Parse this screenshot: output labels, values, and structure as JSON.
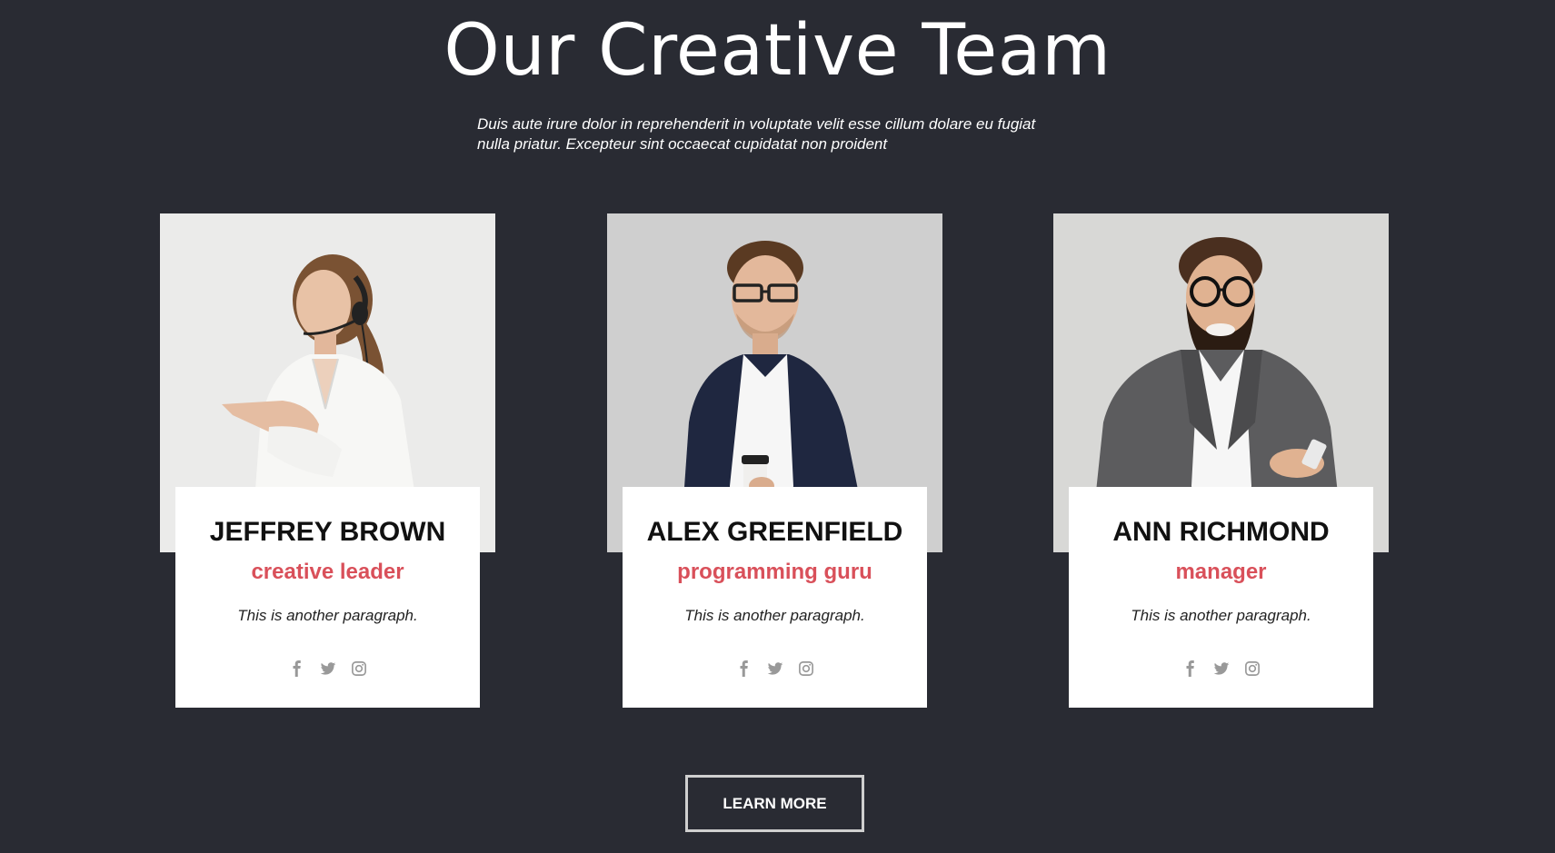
{
  "header": {
    "title": "Our Creative Team",
    "intro": "Duis aute irure dolor in reprehenderit in voluptate velit esse cillum dolare eu fugiat nulla priatur. Excepteur sint occaecat cupidatat non proident"
  },
  "team": [
    {
      "name": "JEFFREY BROWN",
      "role": "creative leader",
      "text": "This is another paragraph.",
      "social": [
        "facebook-icon",
        "twitter-icon",
        "instagram-icon"
      ]
    },
    {
      "name": "ALEX GREENFIELD",
      "role": "programming guru",
      "text": "This is another paragraph.",
      "social": [
        "facebook-icon",
        "twitter-icon",
        "instagram-icon"
      ]
    },
    {
      "name": "ANN RICHMOND",
      "role": "manager",
      "text": "This is another paragraph.",
      "social": [
        "facebook-icon",
        "twitter-icon",
        "instagram-icon"
      ]
    }
  ],
  "cta": {
    "label": "LEARN MORE"
  },
  "colors": {
    "background": "#292b33",
    "accent": "#d9505a",
    "card": "#ffffff",
    "icon": "#999999"
  }
}
